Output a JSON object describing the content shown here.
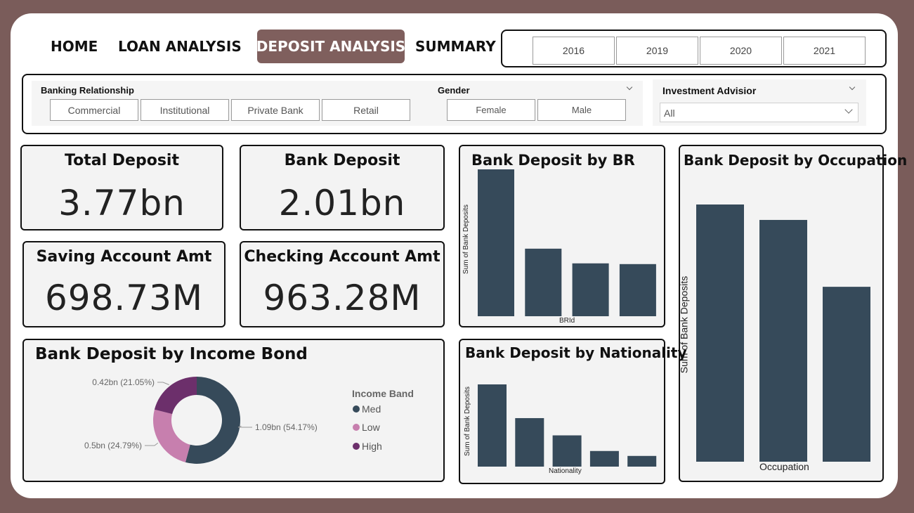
{
  "nav": {
    "home": "HOME",
    "loan_analysis": "LOAN ANALYSIS",
    "deposit_analysis": "DEPOSIT ANALYSIS",
    "summary": "SUMMARY"
  },
  "years": [
    "2016",
    "2019",
    "2020",
    "2021"
  ],
  "filters": {
    "banking_relationship": {
      "label": "Banking Relationship",
      "options": [
        "Commercial",
        "Institutional",
        "Private Bank",
        "Retail"
      ]
    },
    "gender": {
      "label": "Gender",
      "options": [
        "Female",
        "Male"
      ]
    },
    "investment_advisor": {
      "label": "Investment Advisior",
      "value": "All"
    }
  },
  "kpis": {
    "total_deposit": {
      "title": "Total Deposit",
      "value": "3.77bn"
    },
    "bank_deposit": {
      "title": "Bank Deposit",
      "value": "2.01bn"
    },
    "saving_account": {
      "title": "Saving Account Amt",
      "value": "698.73M"
    },
    "checking_account": {
      "title": "Checking Account Amt",
      "value": "963.28M"
    }
  },
  "colors": {
    "bar": "#364a5a",
    "accent": "#7f5f5d",
    "med": "#364a5a",
    "low": "#c77fae",
    "high": "#6c2f6b"
  },
  "chart_data": [
    {
      "type": "bar",
      "title": "Bank Deposit by BR",
      "xlabel": "BRId",
      "ylabel": "Sum of Bank Deposits",
      "values": [
        1.0,
        0.46,
        0.36,
        0.355
      ]
    },
    {
      "type": "bar",
      "title": "Bank Deposit by Occupation",
      "xlabel": "Occupation",
      "ylabel": "Sum of Bank Deposits",
      "values": [
        1.0,
        0.94,
        0.68
      ]
    },
    {
      "type": "bar",
      "title": "Bank Deposit by Nationality",
      "xlabel": "Nationality",
      "ylabel": "Sum of Bank Deposits",
      "values": [
        1.0,
        0.59,
        0.38,
        0.19,
        0.13
      ]
    },
    {
      "type": "pie",
      "title": "Bank  Deposit by Income Bond",
      "legend_title": "Income Band",
      "slices": [
        {
          "name": "Med",
          "value": 1.09,
          "label": "1.09bn (54.17%)",
          "percent": 54.17
        },
        {
          "name": "Low",
          "value": 0.5,
          "label": "0.5bn (24.79%)",
          "percent": 24.79
        },
        {
          "name": "High",
          "value": 0.42,
          "label": "0.42bn (21.05%)",
          "percent": 21.05
        }
      ]
    }
  ]
}
